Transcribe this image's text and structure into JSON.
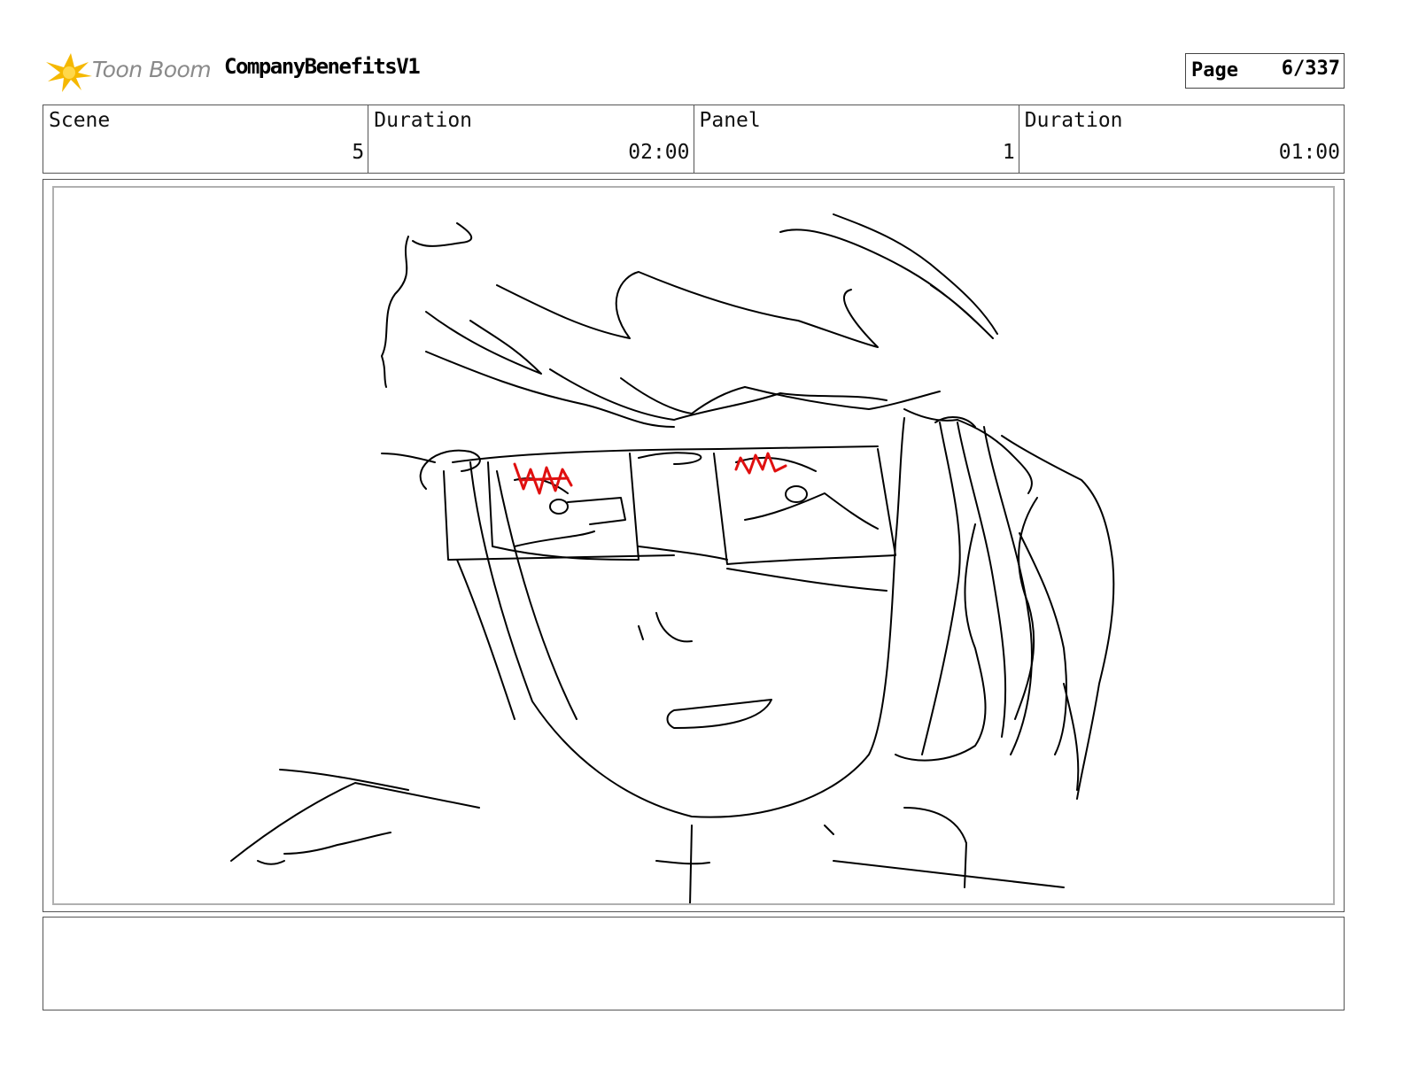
{
  "header": {
    "logo_text": "Toon Boom",
    "logo_color": "#f5b800",
    "project_title": "CompanyBenefitsV1",
    "page_label": "Page",
    "page_value": "6/337"
  },
  "info": {
    "scene_label": "Scene",
    "scene_value": "5",
    "scene_duration_label": "Duration",
    "scene_duration_value": "02:00",
    "panel_label": "Panel",
    "panel_value": "1",
    "panel_duration_label": "Duration",
    "panel_duration_value": "01:00"
  },
  "panel": {
    "line_color": "#000000",
    "accent_color": "#e01010"
  },
  "notes": {
    "text": ""
  }
}
